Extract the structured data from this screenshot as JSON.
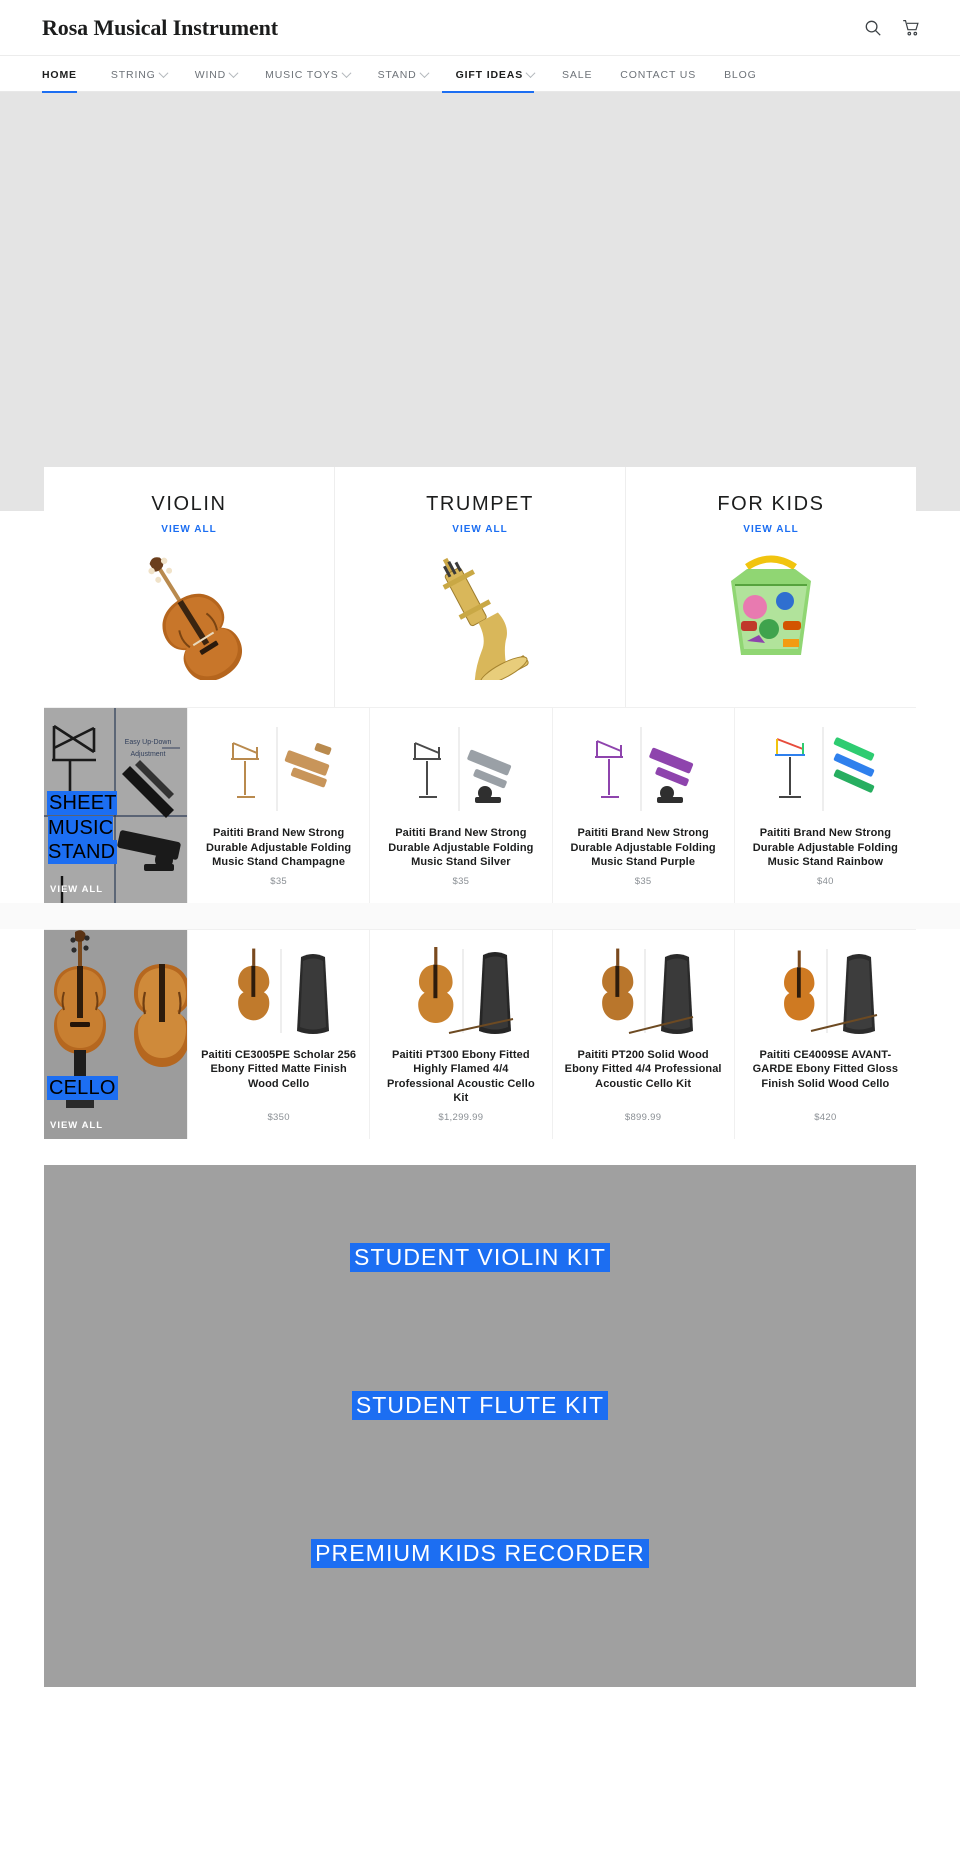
{
  "header": {
    "brand": "Rosa Musical Instrument",
    "search_icon": "search-icon",
    "cart_icon": "cart-icon"
  },
  "nav": {
    "items": [
      {
        "label": "HOME",
        "has_caret": false,
        "active": true
      },
      {
        "label": "STRING",
        "has_caret": true,
        "active": false
      },
      {
        "label": "WIND",
        "has_caret": true,
        "active": false
      },
      {
        "label": "MUSIC TOYS",
        "has_caret": true,
        "active": false
      },
      {
        "label": "STAND",
        "has_caret": true,
        "active": false
      },
      {
        "label": "GIFT IDEAS",
        "has_caret": true,
        "active": true
      },
      {
        "label": "SALE",
        "has_caret": false,
        "active": false
      },
      {
        "label": "CONTACT US",
        "has_caret": false,
        "active": false
      },
      {
        "label": "BLOG",
        "has_caret": false,
        "active": false
      }
    ]
  },
  "categories": [
    {
      "title": "VIOLIN",
      "view_all": "VIEW ALL",
      "image": "violin-photo"
    },
    {
      "title": "TRUMPET",
      "view_all": "VIEW ALL",
      "image": "trumpet-photo"
    },
    {
      "title": "FOR KIDS",
      "view_all": "VIEW ALL",
      "image": "kids-percussion-bag-photo"
    }
  ],
  "collections": [
    {
      "banner_title": "SHEET MUSIC STAND",
      "banner_view_all": "VIEW ALL",
      "banner_image": "music-stand-grid-photo",
      "products": [
        {
          "title": "Paititi Brand New Strong Durable Adjustable Folding Music Stand Champagne",
          "price": "$35",
          "image": "music-stand-champagne-photo"
        },
        {
          "title": "Paititi Brand New Strong Durable Adjustable Folding Music Stand Silver",
          "price": "$35",
          "image": "music-stand-silver-photo"
        },
        {
          "title": "Paititi Brand New Strong Durable Adjustable Folding Music Stand Purple",
          "price": "$35",
          "image": "music-stand-purple-photo"
        },
        {
          "title": "Paititi Brand New Strong Durable Adjustable Folding Music Stand Rainbow",
          "price": "$40",
          "image": "music-stand-rainbow-photo"
        }
      ]
    },
    {
      "banner_title": "CELLO",
      "banner_view_all": "VIEW ALL",
      "banner_image": "cello-pair-photo",
      "products": [
        {
          "title": "Paititi CE3005PE Scholar 256 Ebony Fitted Matte Finish Wood Cello",
          "price": "$350",
          "image": "cello-ce3005pe-photo"
        },
        {
          "title": "Paititi PT300 Ebony Fitted Highly Flamed 4/4 Professional Acoustic Cello Kit",
          "price": "$1,299.99",
          "image": "cello-pt300-photo"
        },
        {
          "title": "Paititi PT200 Solid Wood Ebony Fitted 4/4 Professional Acoustic Cello Kit",
          "price": "$899.99",
          "image": "cello-pt200-photo"
        },
        {
          "title": "Paititi CE4009SE AVANT-GARDE Ebony Fitted Gloss Finish Solid Wood Cello",
          "price": "$420",
          "image": "cello-ce4009se-photo"
        }
      ]
    }
  ],
  "bottom_banners": [
    {
      "title": "STUDENT VIOLIN KIT"
    },
    {
      "title": "STUDENT FLUTE KIT"
    },
    {
      "title": "PREMIUM KIDS RECORDER"
    }
  ],
  "colors": {
    "accent_blue": "#1c6ef2",
    "hero_bg": "#e4e4e4",
    "banner_bg": "#a0a0a0",
    "text": "#1c1d1d",
    "muted": "#8a8f94"
  }
}
